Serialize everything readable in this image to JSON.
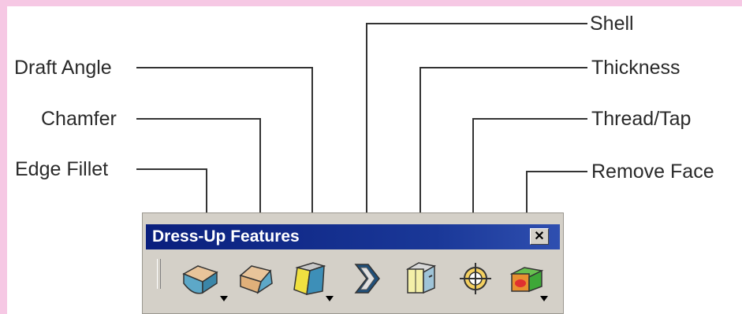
{
  "callouts": {
    "shell": "Shell",
    "draft_angle": "Draft Angle",
    "thickness": "Thickness",
    "chamfer": "Chamfer",
    "thread_tap": "Thread/Tap",
    "edge_fillet": "Edge Fillet",
    "remove_face": "Remove Face"
  },
  "toolbar": {
    "title": "Dress-Up Features",
    "close_glyph": "✕",
    "tools": [
      {
        "name": "edge-fillet",
        "icon": "edge-fillet-icon",
        "has_dropdown": true
      },
      {
        "name": "chamfer",
        "icon": "chamfer-icon",
        "has_dropdown": false
      },
      {
        "name": "draft-angle",
        "icon": "draft-angle-icon",
        "has_dropdown": true
      },
      {
        "name": "shell",
        "icon": "shell-icon",
        "has_dropdown": false
      },
      {
        "name": "thickness",
        "icon": "thickness-icon",
        "has_dropdown": false
      },
      {
        "name": "thread-tap",
        "icon": "thread-tap-icon",
        "has_dropdown": false
      },
      {
        "name": "remove-face",
        "icon": "remove-face-icon",
        "has_dropdown": true
      }
    ]
  },
  "colors": {
    "frame": "#f6c8e4",
    "titlebar": "#0a1f7d",
    "toolbar_bg": "#d4d0c8",
    "leader": "#333333"
  }
}
